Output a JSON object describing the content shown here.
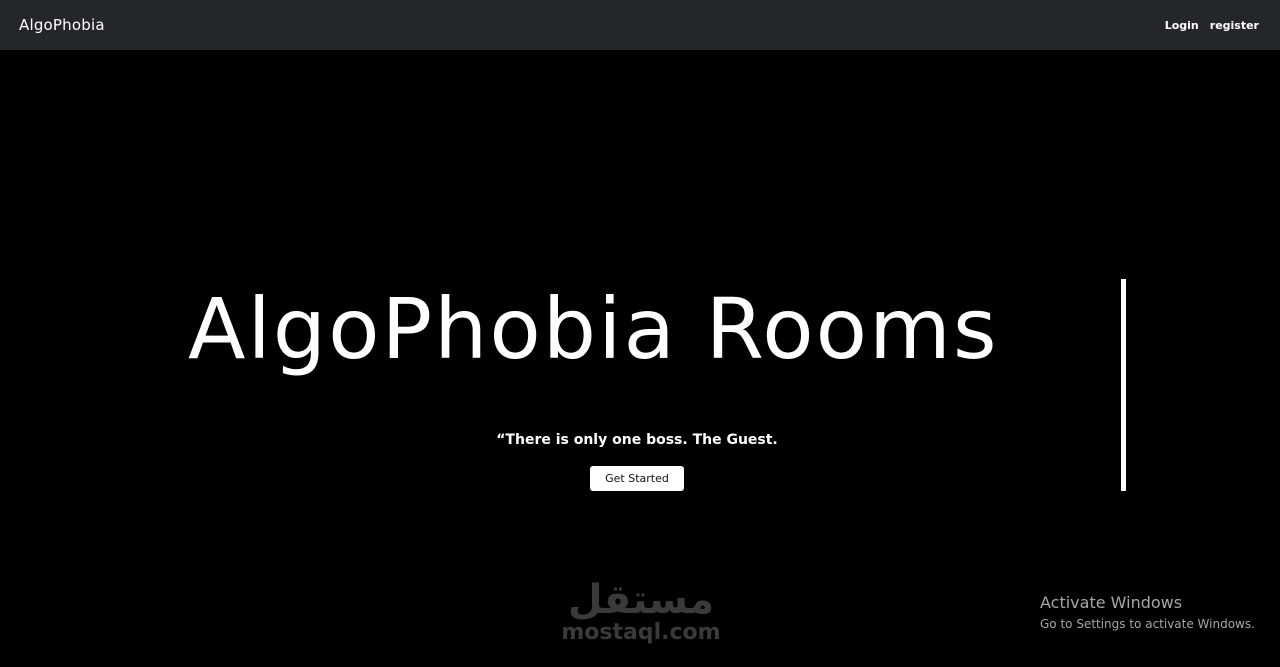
{
  "navbar": {
    "brand": "AlgoPhobia",
    "links": [
      {
        "label": "Login"
      },
      {
        "label": "register"
      }
    ]
  },
  "hero": {
    "title": "AlgoPhobia Rooms",
    "quote": "“There is only one boss. The Guest.",
    "cta_label": "Get Started"
  },
  "watermark": {
    "arabic": "مستقل",
    "latin": "mostaql.com"
  },
  "os_overlay": {
    "title": "Activate Windows",
    "subtitle": "Go to Settings to activate Windows."
  },
  "colors": {
    "navbar_bg": "#23272b",
    "page_bg": "#000000",
    "text": "#ffffff",
    "button_bg": "#ffffff"
  }
}
